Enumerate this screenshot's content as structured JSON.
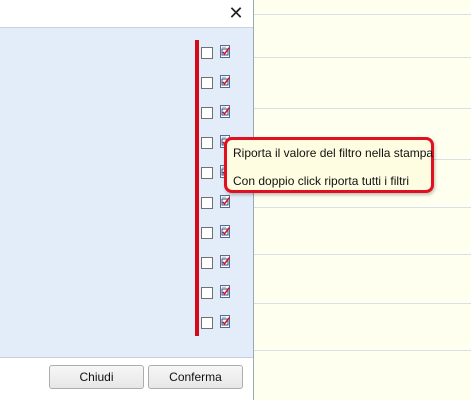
{
  "dialog": {
    "close_glyph": "✕",
    "buttons": {
      "close_label": "Chiudi",
      "confirm_label": "Conferma"
    }
  },
  "filter_rows": [
    {
      "checked": false
    },
    {
      "checked": false
    },
    {
      "checked": false
    },
    {
      "checked": false
    },
    {
      "checked": false
    },
    {
      "checked": false
    },
    {
      "checked": false
    },
    {
      "checked": false
    },
    {
      "checked": false
    },
    {
      "checked": false
    }
  ],
  "tooltip": {
    "line1": "Riporta il valore del filtro nella stampa",
    "line2": "Con doppio click riporta tutti i filtri"
  },
  "colors": {
    "highlight": "#d40a1a",
    "dialog_body": "#e3edfa",
    "tooltip_bg": "#fffde1"
  },
  "icons": {
    "close": "close-icon",
    "print_filter": "print-filter-icon"
  }
}
